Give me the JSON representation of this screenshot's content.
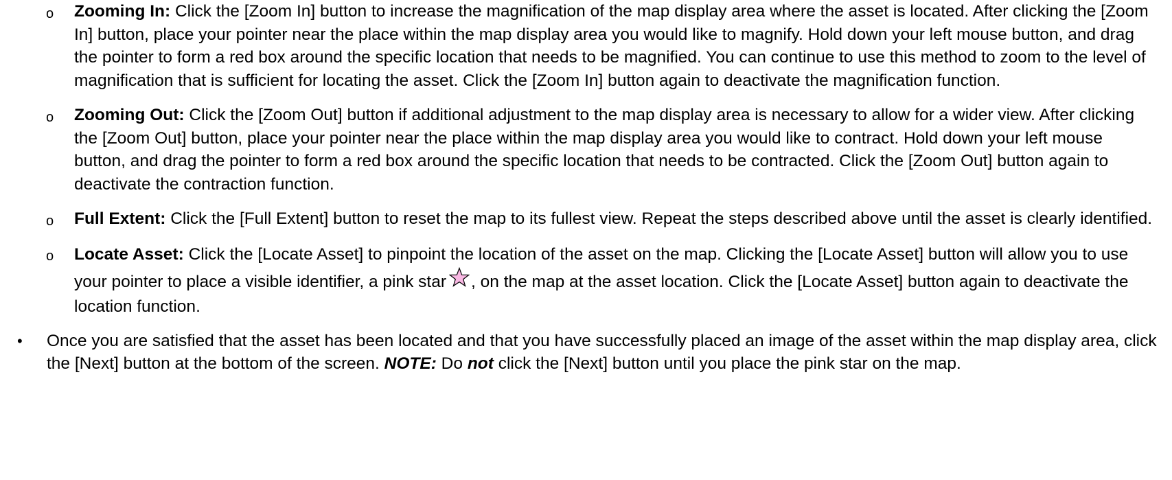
{
  "colors": {
    "text": "#000000",
    "background": "#ffffff",
    "star_fill": "#f9b8e3"
  },
  "sub_items": [
    {
      "bullet": "o",
      "term": "Zooming In:",
      "text": " Click the [Zoom In] button to increase the magnification of the map display area where the asset is located. After clicking the [Zoom In] button, place your pointer near the place within the map display area you would like to magnify. Hold down your left mouse button, and drag the pointer to form a red box around the specific location that needs to be magnified. You can continue to use this method to zoom to the level of magnification that is sufficient for locating the asset. Click the [Zoom In] button again to deactivate the magnification function."
    },
    {
      "bullet": "o",
      "term": "Zooming Out:",
      "text": " Click the [Zoom Out] button if additional adjustment to the map display area is necessary to allow for a wider view. After clicking the [Zoom Out] button, place your pointer near the place within the map display area you would like to contract. Hold down your left mouse button, and drag the pointer to form a red box around the specific location that needs to be contracted. Click the [Zoom Out] button again to deactivate the contraction function."
    },
    {
      "bullet": "o",
      "term": "Full Extent:",
      "text": " Click the [Full Extent] button to reset the map to its fullest view. Repeat the steps described above until the asset is clearly identified."
    },
    {
      "bullet": "o",
      "term": "Locate Asset:",
      "text_before_star": " Click the [Locate Asset] to pinpoint the location of the asset on the map. Clicking the [Locate Asset] button will allow you to use your pointer to place a visible identifier, a pink star",
      "star_icon": "pink-star-icon",
      "text_after_star": ", on the map at the asset location. Click the [Locate Asset] button again to deactivate the location function."
    }
  ],
  "main_item": {
    "bullet": "•",
    "text_1": "Once you are satisfied that the asset has been located and that you have successfully placed an image of the asset within the map display area, click the [Next] button at the bottom of the screen. ",
    "note_label": "NOTE:",
    "text_2": " Do ",
    "emphasis": "not",
    "text_3": " click the [Next] button until you place the pink star on the map."
  }
}
